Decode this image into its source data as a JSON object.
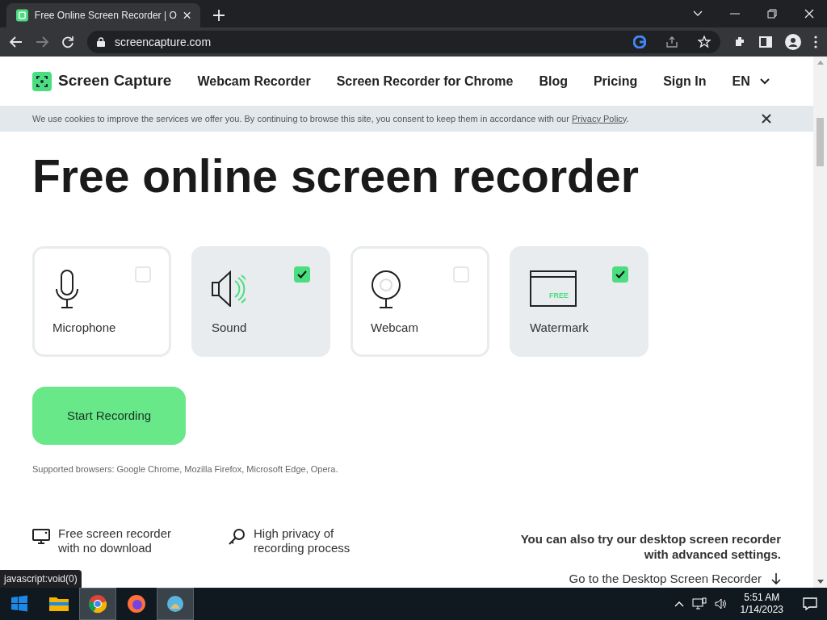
{
  "browser": {
    "tab_title": "Free Online Screen Recorder | O",
    "address": "screencapture.com"
  },
  "nav": {
    "logo": "Screen Capture",
    "links": [
      "Webcam Recorder",
      "Screen Recorder for Chrome",
      "Blog",
      "Pricing",
      "Sign In"
    ],
    "language": "EN"
  },
  "cookie_banner": {
    "text": "We use cookies to improve the services we offer you. By continuing to browse this site, you consent to keep them in accordance with our",
    "link": "Privacy Policy",
    "end": "."
  },
  "heading": "Free online screen recorder",
  "options": [
    {
      "kind": "microphone",
      "label": "Microphone",
      "checked": false
    },
    {
      "kind": "sound",
      "label": "Sound",
      "checked": true
    },
    {
      "kind": "webcam",
      "label": "Webcam",
      "checked": false
    },
    {
      "kind": "watermark",
      "label": "Watermark",
      "checked": true,
      "badge": "FREE"
    }
  ],
  "start_button": "Start Recording",
  "supported": "Supported browsers: Google Chrome, Mozilla Firefox, Microsoft Edge, Opera.",
  "features": [
    {
      "kind": "monitor",
      "text": "Free screen recorder with no download"
    },
    {
      "kind": "key",
      "text": "High privacy of recording process"
    }
  ],
  "desktop_promo": {
    "text": "You can also try our desktop screen recorder with advanced settings.",
    "link": "Go to the Desktop Screen Recorder"
  },
  "status_tooltip": "javascript:void(0)",
  "taskbar": {
    "time": "5:51 AM",
    "date": "1/14/2023"
  }
}
